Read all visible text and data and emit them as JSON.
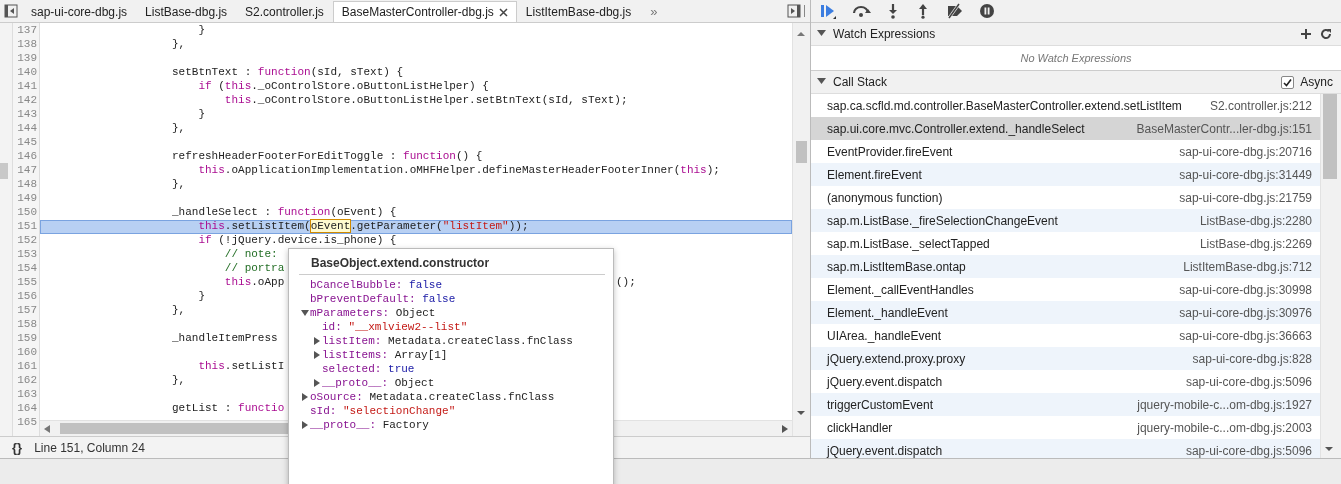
{
  "editor": {
    "tabs": [
      {
        "label": "sap-ui-core-dbg.js",
        "selected": false
      },
      {
        "label": "ListBase-dbg.js",
        "selected": false
      },
      {
        "label": "S2.controller.js",
        "selected": false
      },
      {
        "label": "BaseMasterController-dbg.js",
        "selected": true
      },
      {
        "label": "ListItemBase-dbg.js",
        "selected": false
      }
    ],
    "overflow": "»",
    "lines": [
      {
        "number": "137",
        "kind": "body",
        "selected": false,
        "tokens": [
          {
            "kind": "plain",
            "text": "}"
          }
        ]
      },
      {
        "number": "138",
        "kind": "member",
        "selected": false,
        "tokens": [
          {
            "kind": "plain",
            "text": "},"
          }
        ]
      },
      {
        "number": "139",
        "kind": "blank",
        "selected": false
      },
      {
        "number": "140",
        "kind": "member",
        "selected": false,
        "tokens": [
          {
            "kind": "plain",
            "text": "setBtnText : "
          },
          {
            "kind": "keyword",
            "text": "function"
          },
          {
            "kind": "plain",
            "text": "(sId, sText) {"
          }
        ]
      },
      {
        "number": "141",
        "kind": "body",
        "selected": false,
        "tokens": [
          {
            "kind": "keyword",
            "text": "if"
          },
          {
            "kind": "plain",
            "text": " ("
          },
          {
            "kind": "keyword",
            "text": "this"
          },
          {
            "kind": "plain",
            "text": "._oControlStore.oButtonListHelper) {"
          }
        ]
      },
      {
        "number": "142",
        "kind": "inner",
        "selected": false,
        "tokens": [
          {
            "kind": "keyword",
            "text": "this"
          },
          {
            "kind": "plain",
            "text": "._oControlStore.oButtonListHelper.setBtnText(sId, sText);"
          }
        ]
      },
      {
        "number": "143",
        "kind": "body",
        "selected": false,
        "tokens": [
          {
            "kind": "plain",
            "text": "}"
          }
        ]
      },
      {
        "number": "144",
        "kind": "member",
        "selected": false,
        "tokens": [
          {
            "kind": "plain",
            "text": "},"
          }
        ]
      },
      {
        "number": "145",
        "kind": "blank",
        "selected": false
      },
      {
        "number": "146",
        "kind": "member",
        "selected": false,
        "tokens": [
          {
            "kind": "plain",
            "text": "refreshHeaderFooterForEditToggle : "
          },
          {
            "kind": "keyword",
            "text": "function"
          },
          {
            "kind": "plain",
            "text": "() {"
          }
        ]
      },
      {
        "number": "147",
        "kind": "body",
        "selected": false,
        "tokens": [
          {
            "kind": "keyword",
            "text": "this"
          },
          {
            "kind": "plain",
            "text": ".oApplicationImplementation.oMHFHelper.defineMasterHeaderFooterInner("
          },
          {
            "kind": "keyword",
            "text": "this"
          },
          {
            "kind": "plain",
            "text": ");"
          }
        ]
      },
      {
        "number": "148",
        "kind": "member",
        "selected": false,
        "tokens": [
          {
            "kind": "plain",
            "text": "},"
          }
        ]
      },
      {
        "number": "149",
        "kind": "blank",
        "selected": false
      },
      {
        "number": "150",
        "kind": "member",
        "selected": false,
        "tokens": [
          {
            "kind": "plain",
            "text": "_handleSelect : "
          },
          {
            "kind": "keyword",
            "text": "function"
          },
          {
            "kind": "plain",
            "text": "(oEvent) {"
          }
        ]
      },
      {
        "number": "151",
        "kind": "body",
        "selected": true,
        "tokens": [
          {
            "kind": "keyword",
            "text": "this"
          },
          {
            "kind": "plain",
            "text": ".setListItem("
          },
          {
            "kind": "match",
            "text": "oEvent"
          },
          {
            "kind": "plain",
            "text": ".getParameter("
          },
          {
            "kind": "string",
            "text": "\"listItem\""
          },
          {
            "kind": "plain",
            "text": "));"
          }
        ]
      },
      {
        "number": "152",
        "kind": "body",
        "selected": false,
        "tokens": [
          {
            "kind": "keyword",
            "text": "if"
          },
          {
            "kind": "plain",
            "text": " (!jQuery.device.is_phone) {"
          }
        ]
      },
      {
        "number": "153",
        "kind": "inner",
        "selected": false,
        "tokens": [
          {
            "kind": "comment",
            "text": "// note:"
          }
        ]
      },
      {
        "number": "154",
        "kind": "inner",
        "selected": false,
        "tokens": [
          {
            "kind": "comment",
            "text": "// portra"
          }
        ]
      },
      {
        "number": "155",
        "kind": "inner",
        "selected": false,
        "tokens": [
          {
            "kind": "keyword",
            "text": "this"
          },
          {
            "kind": "plain",
            "text": ".oApp"
          }
        ],
        "tail": "();"
      },
      {
        "number": "156",
        "kind": "body",
        "selected": false,
        "tokens": [
          {
            "kind": "plain",
            "text": "}"
          }
        ]
      },
      {
        "number": "157",
        "kind": "member",
        "selected": false,
        "tokens": [
          {
            "kind": "plain",
            "text": "},"
          }
        ]
      },
      {
        "number": "158",
        "kind": "blank",
        "selected": false
      },
      {
        "number": "159",
        "kind": "member",
        "selected": false,
        "tokens": [
          {
            "kind": "plain",
            "text": "_handleItemPress"
          }
        ]
      },
      {
        "number": "160",
        "kind": "blank",
        "selected": false
      },
      {
        "number": "161",
        "kind": "body",
        "selected": false,
        "tokens": [
          {
            "kind": "keyword",
            "text": "this"
          },
          {
            "kind": "plain",
            "text": ".setListI"
          }
        ]
      },
      {
        "number": "162",
        "kind": "member",
        "selected": false,
        "tokens": [
          {
            "kind": "plain",
            "text": "},"
          }
        ]
      },
      {
        "number": "163",
        "kind": "blank",
        "selected": false
      },
      {
        "number": "164",
        "kind": "member",
        "selected": false,
        "tokens": [
          {
            "kind": "plain",
            "text": "getList : "
          },
          {
            "kind": "keyword",
            "text": "functio"
          }
        ]
      },
      {
        "number": "165",
        "kind": "blank",
        "selected": false
      }
    ],
    "status": {
      "format_icon": "{}",
      "position": "Line 151, Column 24"
    },
    "popup": {
      "title": "BaseObject.extend.constructor",
      "properties": [
        {
          "kind": "keyword",
          "name": "bCancelBubble:",
          "value": "false"
        },
        {
          "kind": "keyword",
          "name": "bPreventDefault:",
          "value": "false"
        },
        {
          "kind": "group",
          "name": "mParameters:",
          "value": "Object",
          "expanded": true,
          "children": [
            {
              "kind": "string",
              "name": "id:",
              "value": "\"__xmlview2--list\""
            },
            {
              "kind": "group",
              "name": "listItem:",
              "value": "Metadata.createClass.fnClass",
              "expanded": false
            },
            {
              "kind": "group",
              "name": "listItems:",
              "value": "Array[1]",
              "expanded": false
            },
            {
              "kind": "keyword",
              "name": "selected:",
              "value": "true"
            },
            {
              "kind": "group",
              "name": "__proto__:",
              "value": "Object",
              "expanded": false
            }
          ]
        },
        {
          "kind": "group",
          "name": "oSource:",
          "value": "Metadata.createClass.fnClass",
          "expanded": false
        },
        {
          "kind": "string",
          "name": "sId:",
          "value": "\"selectionChange\""
        },
        {
          "kind": "group",
          "name": "__proto__:",
          "value": "Factory",
          "expanded": false
        }
      ]
    }
  },
  "debugger": {
    "watch": {
      "title": "Watch Expressions",
      "expanded": true,
      "empty_text": "No Watch Expressions"
    },
    "call_stack": {
      "title": "Call Stack",
      "expanded": true,
      "async": {
        "label": "Async",
        "checked": true
      },
      "frames": [
        {
          "function": "sap.ca.scfld.md.controller.BaseMasterController.extend.setListItem",
          "location": "S2.controller.js:212",
          "selected": false
        },
        {
          "function": "sap.ui.core.mvc.Controller.extend._handleSelect",
          "location": "BaseMasterContr...ler-dbg.js:151",
          "selected": true
        },
        {
          "function": "EventProvider.fireEvent",
          "location": "sap-ui-core-dbg.js:20716",
          "selected": false
        },
        {
          "function": "Element.fireEvent",
          "location": "sap-ui-core-dbg.js:31449",
          "selected": false
        },
        {
          "function": "(anonymous function)",
          "location": "sap-ui-core-dbg.js:21759",
          "selected": false
        },
        {
          "function": "sap.m.ListBase._fireSelectionChangeEvent",
          "location": "ListBase-dbg.js:2280",
          "selected": false
        },
        {
          "function": "sap.m.ListBase._selectTapped",
          "location": "ListBase-dbg.js:2269",
          "selected": false
        },
        {
          "function": "sap.m.ListItemBase.ontap",
          "location": "ListItemBase-dbg.js:712",
          "selected": false
        },
        {
          "function": "Element._callEventHandles",
          "location": "sap-ui-core-dbg.js:30998",
          "selected": false
        },
        {
          "function": "Element._handleEvent",
          "location": "sap-ui-core-dbg.js:30976",
          "selected": false
        },
        {
          "function": "UIArea._handleEvent",
          "location": "sap-ui-core-dbg.js:36663",
          "selected": false
        },
        {
          "function": "jQuery.extend.proxy.proxy",
          "location": "sap-ui-core-dbg.js:828",
          "selected": false
        },
        {
          "function": "jQuery.event.dispatch",
          "location": "sap-ui-core-dbg.js:5096",
          "selected": false
        },
        {
          "function": "triggerCustomEvent",
          "location": "jquery-mobile-c...om-dbg.js:1927",
          "selected": false
        },
        {
          "function": "clickHandler",
          "location": "jquery-mobile-c...om-dbg.js:2003",
          "selected": false
        },
        {
          "function": "jQuery.event.dispatch",
          "location": "sap-ui-core-dbg.js:5096",
          "selected": false
        }
      ]
    }
  }
}
